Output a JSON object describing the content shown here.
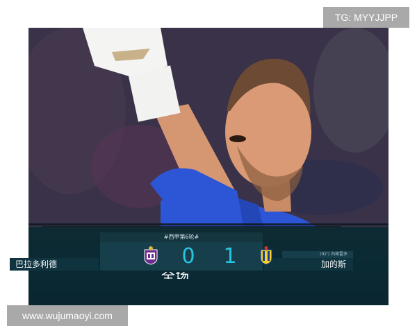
{
  "watermarks": {
    "telegram": "TG: MYYJJPP",
    "website": "www.wujumaoyi.com"
  },
  "scoreboard": {
    "competition": "#西甲第6轮#",
    "home_team": "巴拉多利德",
    "away_team": "加的斯",
    "home_score": "0",
    "away_score": "1",
    "scorer_note": "(92') 内格雷多",
    "bottom_caption": "全场"
  },
  "colors": {
    "score_digits": "#28c4e4",
    "band": "#0a2a33",
    "jersey": "#2d56d6"
  }
}
